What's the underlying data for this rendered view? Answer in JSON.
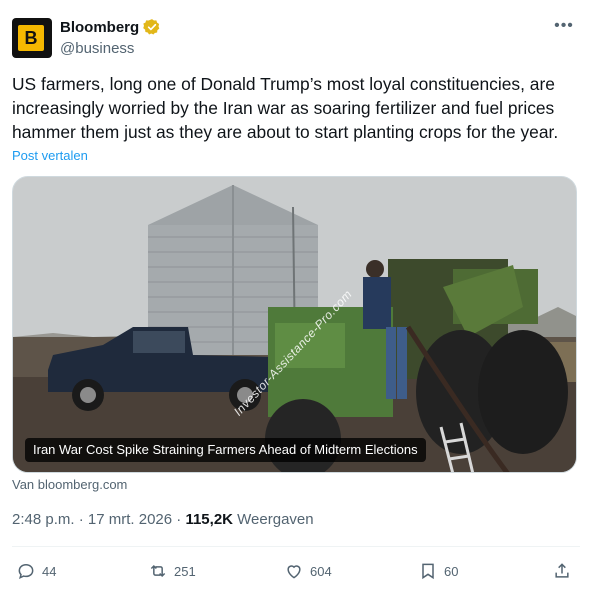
{
  "author": {
    "display_name": "Bloomberg",
    "handle": "@business",
    "avatar_letter": "B",
    "verified_color": "#e2b719"
  },
  "tweet": {
    "text": "US farmers, long one of Donald Trump’s most loyal constituencies, are increasingly worried by the Iran war as soaring fertilizer and fuel prices hammer them just as they are about to start planting crops for the year.",
    "translate_label": "Post vertalen"
  },
  "card": {
    "caption": "Iran War Cost Spike Straining Farmers Ahead of Midterm Elections",
    "watermark": "Investor-Assistance-Pro.com",
    "source": "Van bloomberg.com"
  },
  "meta": {
    "time": "2:48 p.m.",
    "separator": "·",
    "date": "17 mrt. 2026",
    "views_count": "115,2K",
    "views_label": "Weergaven"
  },
  "actions": {
    "replies": "44",
    "reposts": "251",
    "likes": "604",
    "bookmarks": "60"
  }
}
